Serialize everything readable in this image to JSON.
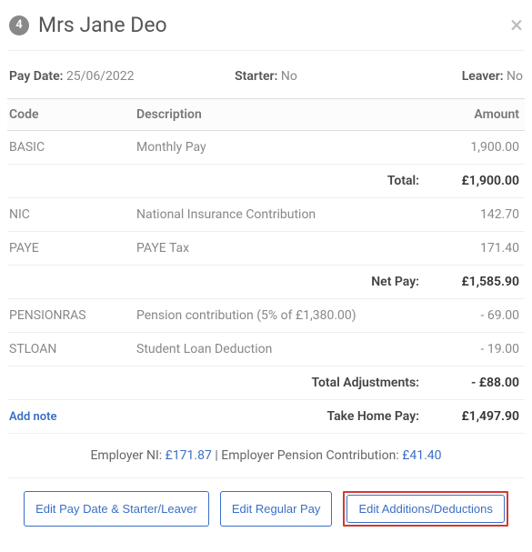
{
  "header": {
    "number": "4",
    "name": "Mrs Jane Deo"
  },
  "meta": {
    "pay_date_label": "Pay Date:",
    "pay_date": "25/06/2022",
    "starter_label": "Starter:",
    "starter": "No",
    "leaver_label": "Leaver:",
    "leaver": "No"
  },
  "thead": {
    "code": "Code",
    "desc": "Description",
    "amount": "Amount"
  },
  "rows": {
    "basic": {
      "code": "BASIC",
      "desc": "Monthly Pay",
      "amt": "1,900.00"
    },
    "total": {
      "label": "Total:",
      "amt": "£1,900.00"
    },
    "nic": {
      "code": "NIC",
      "desc": "National Insurance Contribution",
      "amt": "142.70"
    },
    "paye": {
      "code": "PAYE",
      "desc": "PAYE Tax",
      "amt": "171.40"
    },
    "netpay": {
      "label": "Net Pay:",
      "amt": "£1,585.90"
    },
    "pension": {
      "code": "PENSIONRAS",
      "desc": "Pension contribution (5% of £1,380.00)",
      "amt": "- 69.00"
    },
    "stloan": {
      "code": "STLOAN",
      "desc": "Student Loan Deduction",
      "amt": "- 19.00"
    },
    "adj": {
      "label": "Total Adjustments:",
      "amt": "- £88.00"
    },
    "takehome": {
      "label": "Take Home Pay:",
      "amt": "£1,497.90"
    }
  },
  "add_note": "Add note",
  "employer": {
    "ni_label": "Employer NI: ",
    "ni_value": "£171.87",
    "sep": " | ",
    "pension_label": "Employer Pension Contribution: ",
    "pension_value": "£41.40"
  },
  "buttons": {
    "edit_paydate": "Edit Pay Date & Starter/Leaver",
    "edit_regular": "Edit Regular Pay",
    "edit_additions": "Edit Additions/Deductions"
  }
}
